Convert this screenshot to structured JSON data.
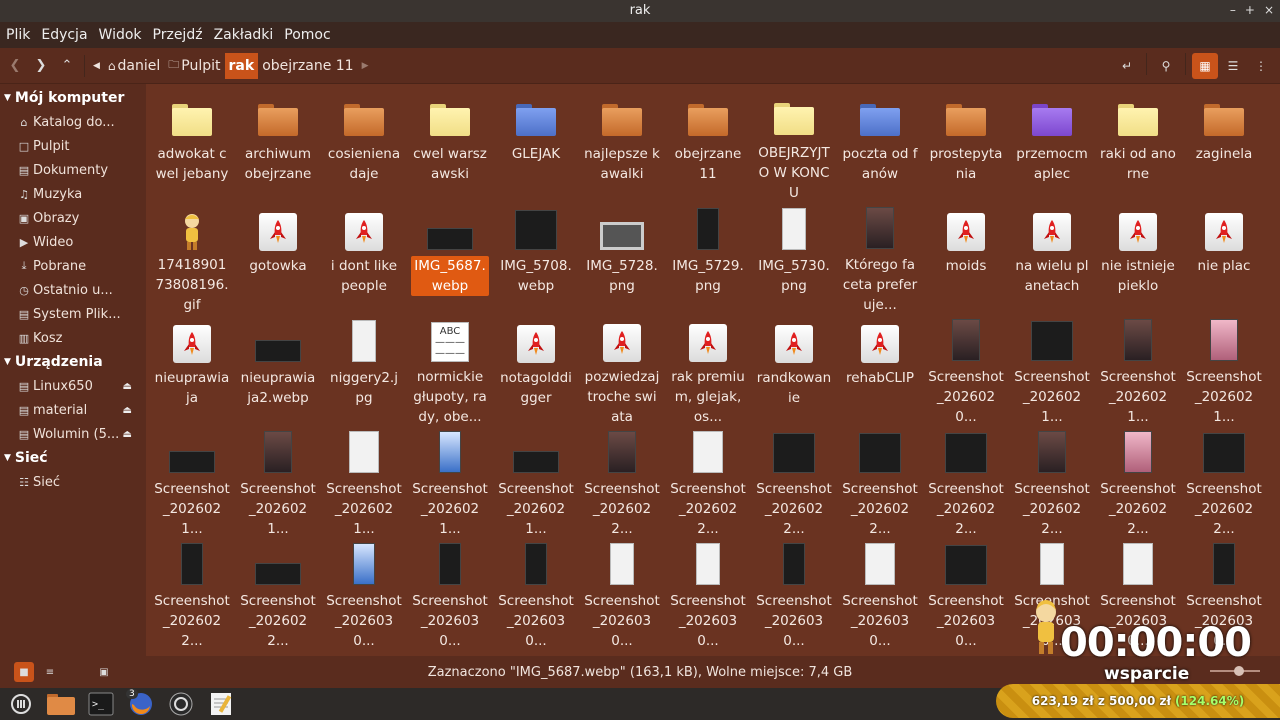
{
  "window": {
    "title": "rak",
    "controls": [
      "–",
      "+",
      "×"
    ]
  },
  "menu": [
    "Plik",
    "Edycja",
    "Widok",
    "Przejdź",
    "Zakładki",
    "Pomoc"
  ],
  "breadcrumb": [
    "daniel",
    "Pulpit",
    "rak",
    "obejrzane 11"
  ],
  "sidebar": {
    "sections": [
      {
        "title": "Mój komputer",
        "items": [
          {
            "label": "Katalog do...",
            "icon": "home-icon"
          },
          {
            "label": "Pulpit",
            "icon": "desktop-icon"
          },
          {
            "label": "Dokumenty",
            "icon": "documents-icon"
          },
          {
            "label": "Muzyka",
            "icon": "music-icon"
          },
          {
            "label": "Obrazy",
            "icon": "pictures-icon"
          },
          {
            "label": "Wideo",
            "icon": "video-icon"
          },
          {
            "label": "Pobrane",
            "icon": "download-icon"
          },
          {
            "label": "Ostatnio u...",
            "icon": "recent-icon"
          },
          {
            "label": "System Plik...",
            "icon": "drive-icon"
          },
          {
            "label": "Kosz",
            "icon": "trash-icon"
          }
        ]
      },
      {
        "title": "Urządzenia",
        "items": [
          {
            "label": "Linux650",
            "icon": "drive-icon",
            "eject": true
          },
          {
            "label": "material",
            "icon": "drive-icon",
            "eject": true
          },
          {
            "label": "Wolumin (5...",
            "icon": "drive-icon",
            "eject": true
          }
        ]
      },
      {
        "title": "Sieć",
        "items": [
          {
            "label": "Sieć",
            "icon": "network-icon"
          }
        ]
      }
    ]
  },
  "files": [
    {
      "name": "adwokat cwel jebany",
      "type": "folder-yellow"
    },
    {
      "name": "archiwum obejrzane",
      "type": "folder-orange"
    },
    {
      "name": "cosieniena daje",
      "type": "folder-orange"
    },
    {
      "name": "cwel warszawski",
      "type": "folder-yellow"
    },
    {
      "name": "GLEJAK",
      "type": "folder-blue"
    },
    {
      "name": "najlepsze kawalki",
      "type": "folder-orange"
    },
    {
      "name": "obejrzane 11",
      "type": "folder-orange"
    },
    {
      "name": "OBEJRZYJTO W KONCU",
      "type": "folder-yellow"
    },
    {
      "name": "poczta od fanów",
      "type": "folder-blue"
    },
    {
      "name": "prostepytania",
      "type": "folder-orange"
    },
    {
      "name": "przemocmaplec",
      "type": "folder-purple"
    },
    {
      "name": "raki od anorne",
      "type": "folder-yellow"
    },
    {
      "name": "zaginela",
      "type": "folder-orange"
    },
    {
      "name": "1741890173808196.gif",
      "type": "gif"
    },
    {
      "name": "gotowka",
      "type": "generic"
    },
    {
      "name": "i dont like people",
      "type": "generic"
    },
    {
      "name": "IMG_5687.webp",
      "type": "shot-wide",
      "selected": true
    },
    {
      "name": "IMG_5708.webp",
      "type": "shot-dark"
    },
    {
      "name": "IMG_5728.png",
      "type": "shot-gray"
    },
    {
      "name": "IMG_5729.png",
      "type": "shot-tall"
    },
    {
      "name": "IMG_5730.png",
      "type": "shot-tall-light"
    },
    {
      "name": "Którego faceta preferuje...",
      "type": "shot-photo"
    },
    {
      "name": "moids",
      "type": "generic"
    },
    {
      "name": "na wielu planetach",
      "type": "generic"
    },
    {
      "name": "nie istnieje pieklo",
      "type": "generic"
    },
    {
      "name": "nie plac",
      "type": "generic"
    },
    {
      "name": "nieuprawiaja",
      "type": "generic"
    },
    {
      "name": "nieuprawiaja2.webp",
      "type": "shot-wide"
    },
    {
      "name": "niggery2.jpg",
      "type": "shot-tall-light"
    },
    {
      "name": "normickie głupoty, rady, obe...",
      "type": "text"
    },
    {
      "name": "notagolddigger",
      "type": "generic"
    },
    {
      "name": "pozwiedzaj troche swiata",
      "type": "generic"
    },
    {
      "name": "rak premium, glejak, os...",
      "type": "generic"
    },
    {
      "name": "randkowanie",
      "type": "generic"
    },
    {
      "name": "rehabCLIP",
      "type": "generic"
    },
    {
      "name": "Screenshot _2026020...",
      "type": "shot-photo"
    },
    {
      "name": "Screenshot _2026021...",
      "type": "shot-dark"
    },
    {
      "name": "Screenshot _2026021...",
      "type": "shot-photo"
    },
    {
      "name": "Screenshot _2026021...",
      "type": "shot-pink"
    },
    {
      "name": "Screenshot _2026021...",
      "type": "shot-wide"
    },
    {
      "name": "Screenshot _2026021...",
      "type": "shot-photo"
    },
    {
      "name": "Screenshot _2026021...",
      "type": "shot-light"
    },
    {
      "name": "Screenshot _2026021...",
      "type": "shot-blue"
    },
    {
      "name": "Screenshot _2026021...",
      "type": "shot-wide"
    },
    {
      "name": "Screenshot _2026022...",
      "type": "shot-photo"
    },
    {
      "name": "Screenshot _2026022...",
      "type": "shot-light"
    },
    {
      "name": "Screenshot _2026022...",
      "type": "shot-dark"
    },
    {
      "name": "Screenshot _2026022...",
      "type": "shot-dark"
    },
    {
      "name": "Screenshot _2026022...",
      "type": "shot-dark"
    },
    {
      "name": "Screenshot _2026022...",
      "type": "shot-photo"
    },
    {
      "name": "Screenshot _2026022...",
      "type": "shot-pink"
    },
    {
      "name": "Screenshot _2026022...",
      "type": "shot-dark"
    },
    {
      "name": "Screenshot _2026022...",
      "type": "shot-tall"
    },
    {
      "name": "Screenshot _2026022...",
      "type": "shot-wide"
    },
    {
      "name": "Screenshot _2026030...",
      "type": "shot-blue"
    },
    {
      "name": "Screenshot _2026030...",
      "type": "shot-tall"
    },
    {
      "name": "Screenshot _2026030...",
      "type": "shot-tall"
    },
    {
      "name": "Screenshot _2026030...",
      "type": "shot-tall-light"
    },
    {
      "name": "Screenshot _2026030...",
      "type": "shot-tall-light"
    },
    {
      "name": "Screenshot _2026030...",
      "type": "shot-tall"
    },
    {
      "name": "Screenshot _2026030...",
      "type": "shot-light"
    },
    {
      "name": "Screenshot _2026030...",
      "type": "shot-dark"
    },
    {
      "name": "Screenshot _2026030...",
      "type": "shot-tall-light"
    },
    {
      "name": "Screenshot _2026030...",
      "type": "shot-light"
    },
    {
      "name": "Screenshot _2026030...",
      "type": "shot-tall"
    }
  ],
  "status": "Zaznaczono \"IMG_5687.webp\" (163,1 kB), Wolne miejsce: 7,4 GB",
  "taskbar": {
    "firefox_badge": "3"
  },
  "overlay": {
    "timer": "00:00:00",
    "label": "wsparcie",
    "goal_text": "623,19 zł z 500,00 zł",
    "goal_pct": "(124.64%)"
  },
  "colors": {
    "accent": "#c9531a",
    "background": "#6a3321",
    "sidebar": "#5a2c1e"
  }
}
